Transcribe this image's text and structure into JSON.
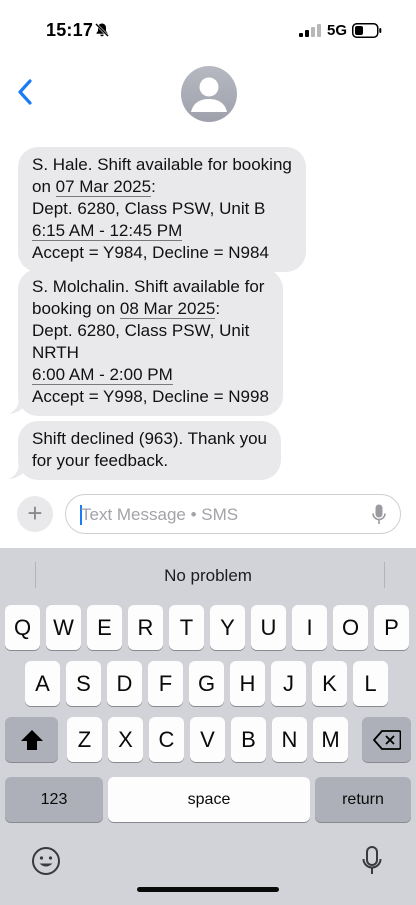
{
  "status_bar": {
    "time": "15:17",
    "network": "5G",
    "icons": [
      "bell-slash-icon",
      "signal-bars-icon",
      "battery-icon"
    ]
  },
  "header": {
    "back_icon": "chevron-left-icon",
    "avatar_icon": "person-silhouette-icon"
  },
  "messages": [
    {
      "lines": [
        [
          {
            "t": "S. Hale. Shift available for booking"
          }
        ],
        [
          {
            "t": "on "
          },
          {
            "t": "07 Mar 2025",
            "u": true
          },
          {
            "t": ":"
          }
        ],
        [
          {
            "t": "Dept. 6280, Class PSW, Unit B"
          }
        ],
        [
          {
            "t": "6:15 AM - 12:45 PM",
            "u": true
          }
        ],
        [
          {
            "t": "Accept = Y984, Decline = N984"
          }
        ]
      ]
    },
    {
      "lines": [
        [
          {
            "t": "S. Molchalin. Shift available for"
          }
        ],
        [
          {
            "t": "booking on "
          },
          {
            "t": "08 Mar 2025",
            "u": true
          },
          {
            "t": ":"
          }
        ],
        [
          {
            "t": "Dept. 6280, Class PSW, Unit"
          }
        ],
        [
          {
            "t": "NRTH"
          }
        ],
        [
          {
            "t": "6:00 AM - 2:00 PM",
            "u": true
          }
        ],
        [
          {
            "t": "Accept = Y998, Decline = N998"
          }
        ]
      ]
    },
    {
      "lines": [
        [
          {
            "t": "Shift declined (963). Thank you"
          }
        ],
        [
          {
            "t": "for your feedback."
          }
        ]
      ]
    }
  ],
  "input": {
    "plus_label": "+",
    "placeholder": "Text Message • SMS"
  },
  "keyboard": {
    "suggestion": "No problem",
    "row1": [
      "Q",
      "W",
      "E",
      "R",
      "T",
      "Y",
      "U",
      "I",
      "O",
      "P"
    ],
    "row2": [
      "A",
      "S",
      "D",
      "F",
      "G",
      "H",
      "J",
      "K",
      "L"
    ],
    "row3": [
      "Z",
      "X",
      "C",
      "V",
      "B",
      "N",
      "M"
    ],
    "numbers_label": "123",
    "space_label": "space",
    "return_label": "return"
  }
}
